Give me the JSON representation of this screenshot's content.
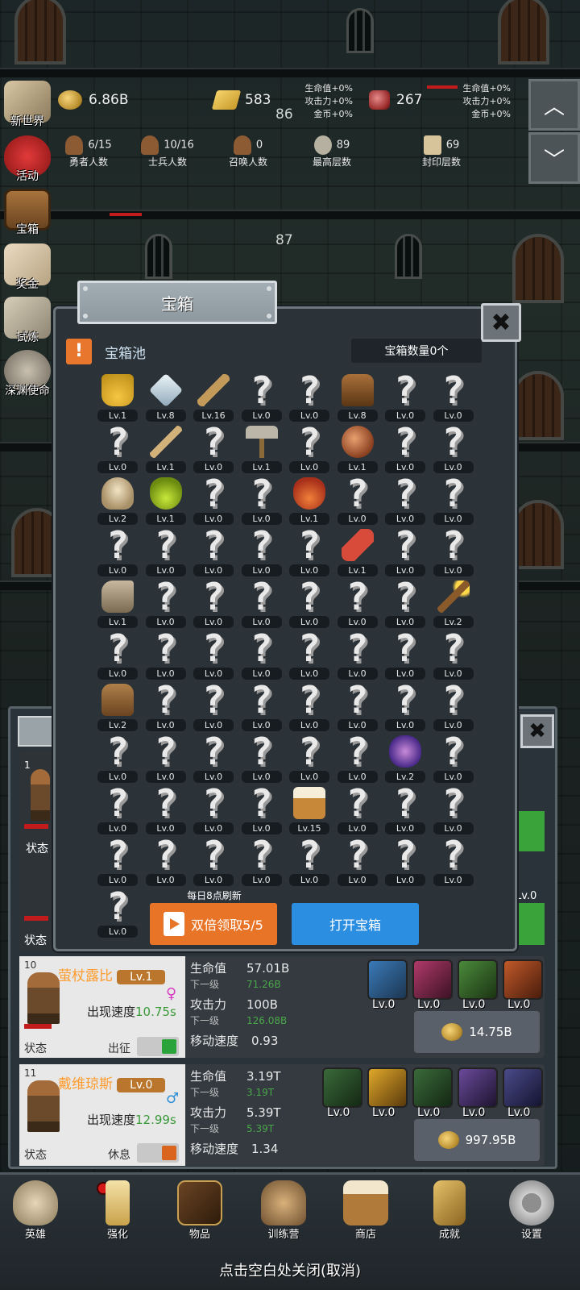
{
  "hud": {
    "gold": "6.86B",
    "bars": "583",
    "gems": "267",
    "bonus1": [
      "生命值+0%",
      "攻击力+0%",
      "金币+0%"
    ],
    "bonus2": [
      "生命值+0%",
      "攻击力+0%",
      "金币+0%"
    ],
    "stats": [
      {
        "value": "6/15",
        "label": "勇者人数"
      },
      {
        "value": "10/16",
        "label": "士兵人数"
      },
      {
        "value": "0",
        "label": "召唤人数"
      },
      {
        "value": "89",
        "label": "最高层数"
      },
      {
        "value": "69",
        "label": "封印层数"
      }
    ],
    "floor_top": "86",
    "floor_mid": "87"
  },
  "side_menu": [
    "新世界",
    "活动",
    "宝箱",
    "奖金",
    "试炼",
    "深渊使命"
  ],
  "panel": {
    "title": "宝箱",
    "pool_label": "宝箱池",
    "chest_count": "宝箱数量0个",
    "refresh_note": "每日8点刷新",
    "double_btn": "双倍领取5/5",
    "open_btn": "打开宝箱"
  },
  "items": [
    {
      "lv": "Lv.1",
      "icon": "crown"
    },
    {
      "lv": "Lv.8",
      "icon": "diamond"
    },
    {
      "lv": "Lv.16",
      "icon": "sword"
    },
    {
      "lv": "Lv.0",
      "icon": "unknown"
    },
    {
      "lv": "Lv.0",
      "icon": "unknown"
    },
    {
      "lv": "Lv.8",
      "icon": "armor"
    },
    {
      "lv": "Lv.0",
      "icon": "unknown"
    },
    {
      "lv": "Lv.0",
      "icon": "unknown"
    },
    {
      "lv": "Lv.0",
      "icon": "unknown"
    },
    {
      "lv": "Lv.1",
      "icon": "dagger"
    },
    {
      "lv": "Lv.0",
      "icon": "unknown"
    },
    {
      "lv": "Lv.1",
      "icon": "hammer"
    },
    {
      "lv": "Lv.0",
      "icon": "unknown"
    },
    {
      "lv": "Lv.1",
      "icon": "meat"
    },
    {
      "lv": "Lv.0",
      "icon": "unknown"
    },
    {
      "lv": "Lv.0",
      "icon": "unknown"
    },
    {
      "lv": "Lv.2",
      "icon": "bread"
    },
    {
      "lv": "Lv.1",
      "icon": "green-potion"
    },
    {
      "lv": "Lv.0",
      "icon": "unknown"
    },
    {
      "lv": "Lv.0",
      "icon": "unknown"
    },
    {
      "lv": "Lv.1",
      "icon": "red-potion"
    },
    {
      "lv": "Lv.0",
      "icon": "unknown"
    },
    {
      "lv": "Lv.0",
      "icon": "unknown"
    },
    {
      "lv": "Lv.0",
      "icon": "unknown"
    },
    {
      "lv": "Lv.0",
      "icon": "unknown"
    },
    {
      "lv": "Lv.0",
      "icon": "unknown"
    },
    {
      "lv": "Lv.0",
      "icon": "unknown"
    },
    {
      "lv": "Lv.0",
      "icon": "unknown"
    },
    {
      "lv": "Lv.0",
      "icon": "unknown"
    },
    {
      "lv": "Lv.1",
      "icon": "bottle"
    },
    {
      "lv": "Lv.0",
      "icon": "unknown"
    },
    {
      "lv": "Lv.0",
      "icon": "unknown"
    },
    {
      "lv": "Lv.1",
      "icon": "boot"
    },
    {
      "lv": "Lv.0",
      "icon": "unknown"
    },
    {
      "lv": "Lv.0",
      "icon": "unknown"
    },
    {
      "lv": "Lv.0",
      "icon": "unknown"
    },
    {
      "lv": "Lv.0",
      "icon": "unknown"
    },
    {
      "lv": "Lv.0",
      "icon": "unknown"
    },
    {
      "lv": "Lv.0",
      "icon": "unknown"
    },
    {
      "lv": "Lv.2",
      "icon": "torch"
    },
    {
      "lv": "Lv.0",
      "icon": "unknown"
    },
    {
      "lv": "Lv.0",
      "icon": "unknown"
    },
    {
      "lv": "Lv.0",
      "icon": "unknown"
    },
    {
      "lv": "Lv.0",
      "icon": "unknown"
    },
    {
      "lv": "Lv.0",
      "icon": "unknown"
    },
    {
      "lv": "Lv.0",
      "icon": "unknown"
    },
    {
      "lv": "Lv.0",
      "icon": "unknown"
    },
    {
      "lv": "Lv.0",
      "icon": "unknown"
    },
    {
      "lv": "Lv.2",
      "icon": "backpack"
    },
    {
      "lv": "Lv.0",
      "icon": "unknown"
    },
    {
      "lv": "Lv.0",
      "icon": "unknown"
    },
    {
      "lv": "Lv.0",
      "icon": "unknown"
    },
    {
      "lv": "Lv.0",
      "icon": "unknown"
    },
    {
      "lv": "Lv.0",
      "icon": "unknown"
    },
    {
      "lv": "Lv.0",
      "icon": "unknown"
    },
    {
      "lv": "Lv.0",
      "icon": "unknown"
    },
    {
      "lv": "Lv.0",
      "icon": "unknown"
    },
    {
      "lv": "Lv.0",
      "icon": "unknown"
    },
    {
      "lv": "Lv.0",
      "icon": "unknown"
    },
    {
      "lv": "Lv.0",
      "icon": "unknown"
    },
    {
      "lv": "Lv.0",
      "icon": "unknown"
    },
    {
      "lv": "Lv.0",
      "icon": "unknown"
    },
    {
      "lv": "Lv.2",
      "icon": "slime"
    },
    {
      "lv": "Lv.0",
      "icon": "unknown"
    },
    {
      "lv": "Lv.0",
      "icon": "unknown"
    },
    {
      "lv": "Lv.0",
      "icon": "unknown"
    },
    {
      "lv": "Lv.0",
      "icon": "unknown"
    },
    {
      "lv": "Lv.0",
      "icon": "unknown"
    },
    {
      "lv": "Lv.15",
      "icon": "beer"
    },
    {
      "lv": "Lv.0",
      "icon": "unknown"
    },
    {
      "lv": "Lv.0",
      "icon": "unknown"
    },
    {
      "lv": "Lv.0",
      "icon": "unknown"
    },
    {
      "lv": "Lv.0",
      "icon": "unknown"
    },
    {
      "lv": "Lv.0",
      "icon": "unknown"
    },
    {
      "lv": "Lv.0",
      "icon": "unknown"
    },
    {
      "lv": "Lv.0",
      "icon": "unknown"
    },
    {
      "lv": "Lv.0",
      "icon": "unknown"
    },
    {
      "lv": "Lv.0",
      "icon": "unknown"
    },
    {
      "lv": "Lv.0",
      "icon": "unknown"
    },
    {
      "lv": "Lv.0",
      "icon": "unknown"
    },
    {
      "lv": "Lv.0",
      "icon": "unknown"
    }
  ],
  "heroes": [
    {
      "index": "10",
      "name": "萤杖露比",
      "level": "Lv.1",
      "speed_label": "出现速度",
      "speed": "10.75s",
      "status_label": "状态",
      "action": "出征",
      "hp_label": "生命值",
      "hp": "57.01B",
      "next_label": "下一级",
      "hp_next": "71.26B",
      "atk_label": "攻击力",
      "atk": "100B",
      "atk_next": "126.08B",
      "move_label": "移动速度",
      "move": "0.93",
      "skills": [
        "Lv.0",
        "Lv.0",
        "Lv.0",
        "Lv.0"
      ],
      "cost": "14.75B"
    },
    {
      "index": "11",
      "name": "戴维琼斯",
      "level": "Lv.0",
      "speed_label": "出现速度",
      "speed": "12.99s",
      "status_label": "状态",
      "action": "休息",
      "hp_label": "生命值",
      "hp": "3.19T",
      "next_label": "下一级",
      "hp_next": "3.19T",
      "atk_label": "攻击力",
      "atk": "5.39T",
      "atk_next": "5.39T",
      "move_label": "移动速度",
      "move": "1.34",
      "skills": [
        "Lv.0",
        "Lv.0",
        "Lv.0",
        "Lv.0",
        "Lv.0"
      ],
      "cost": "997.95B"
    }
  ],
  "behind": {
    "slot1": "1",
    "status1": "状态",
    "status2": "状态",
    "lv_right": "Lv.0"
  },
  "nav": [
    "英雄",
    "强化",
    "物品",
    "训练营",
    "商店",
    "成就",
    "设置"
  ],
  "close_hint": "点击空白处关闭(取消)"
}
